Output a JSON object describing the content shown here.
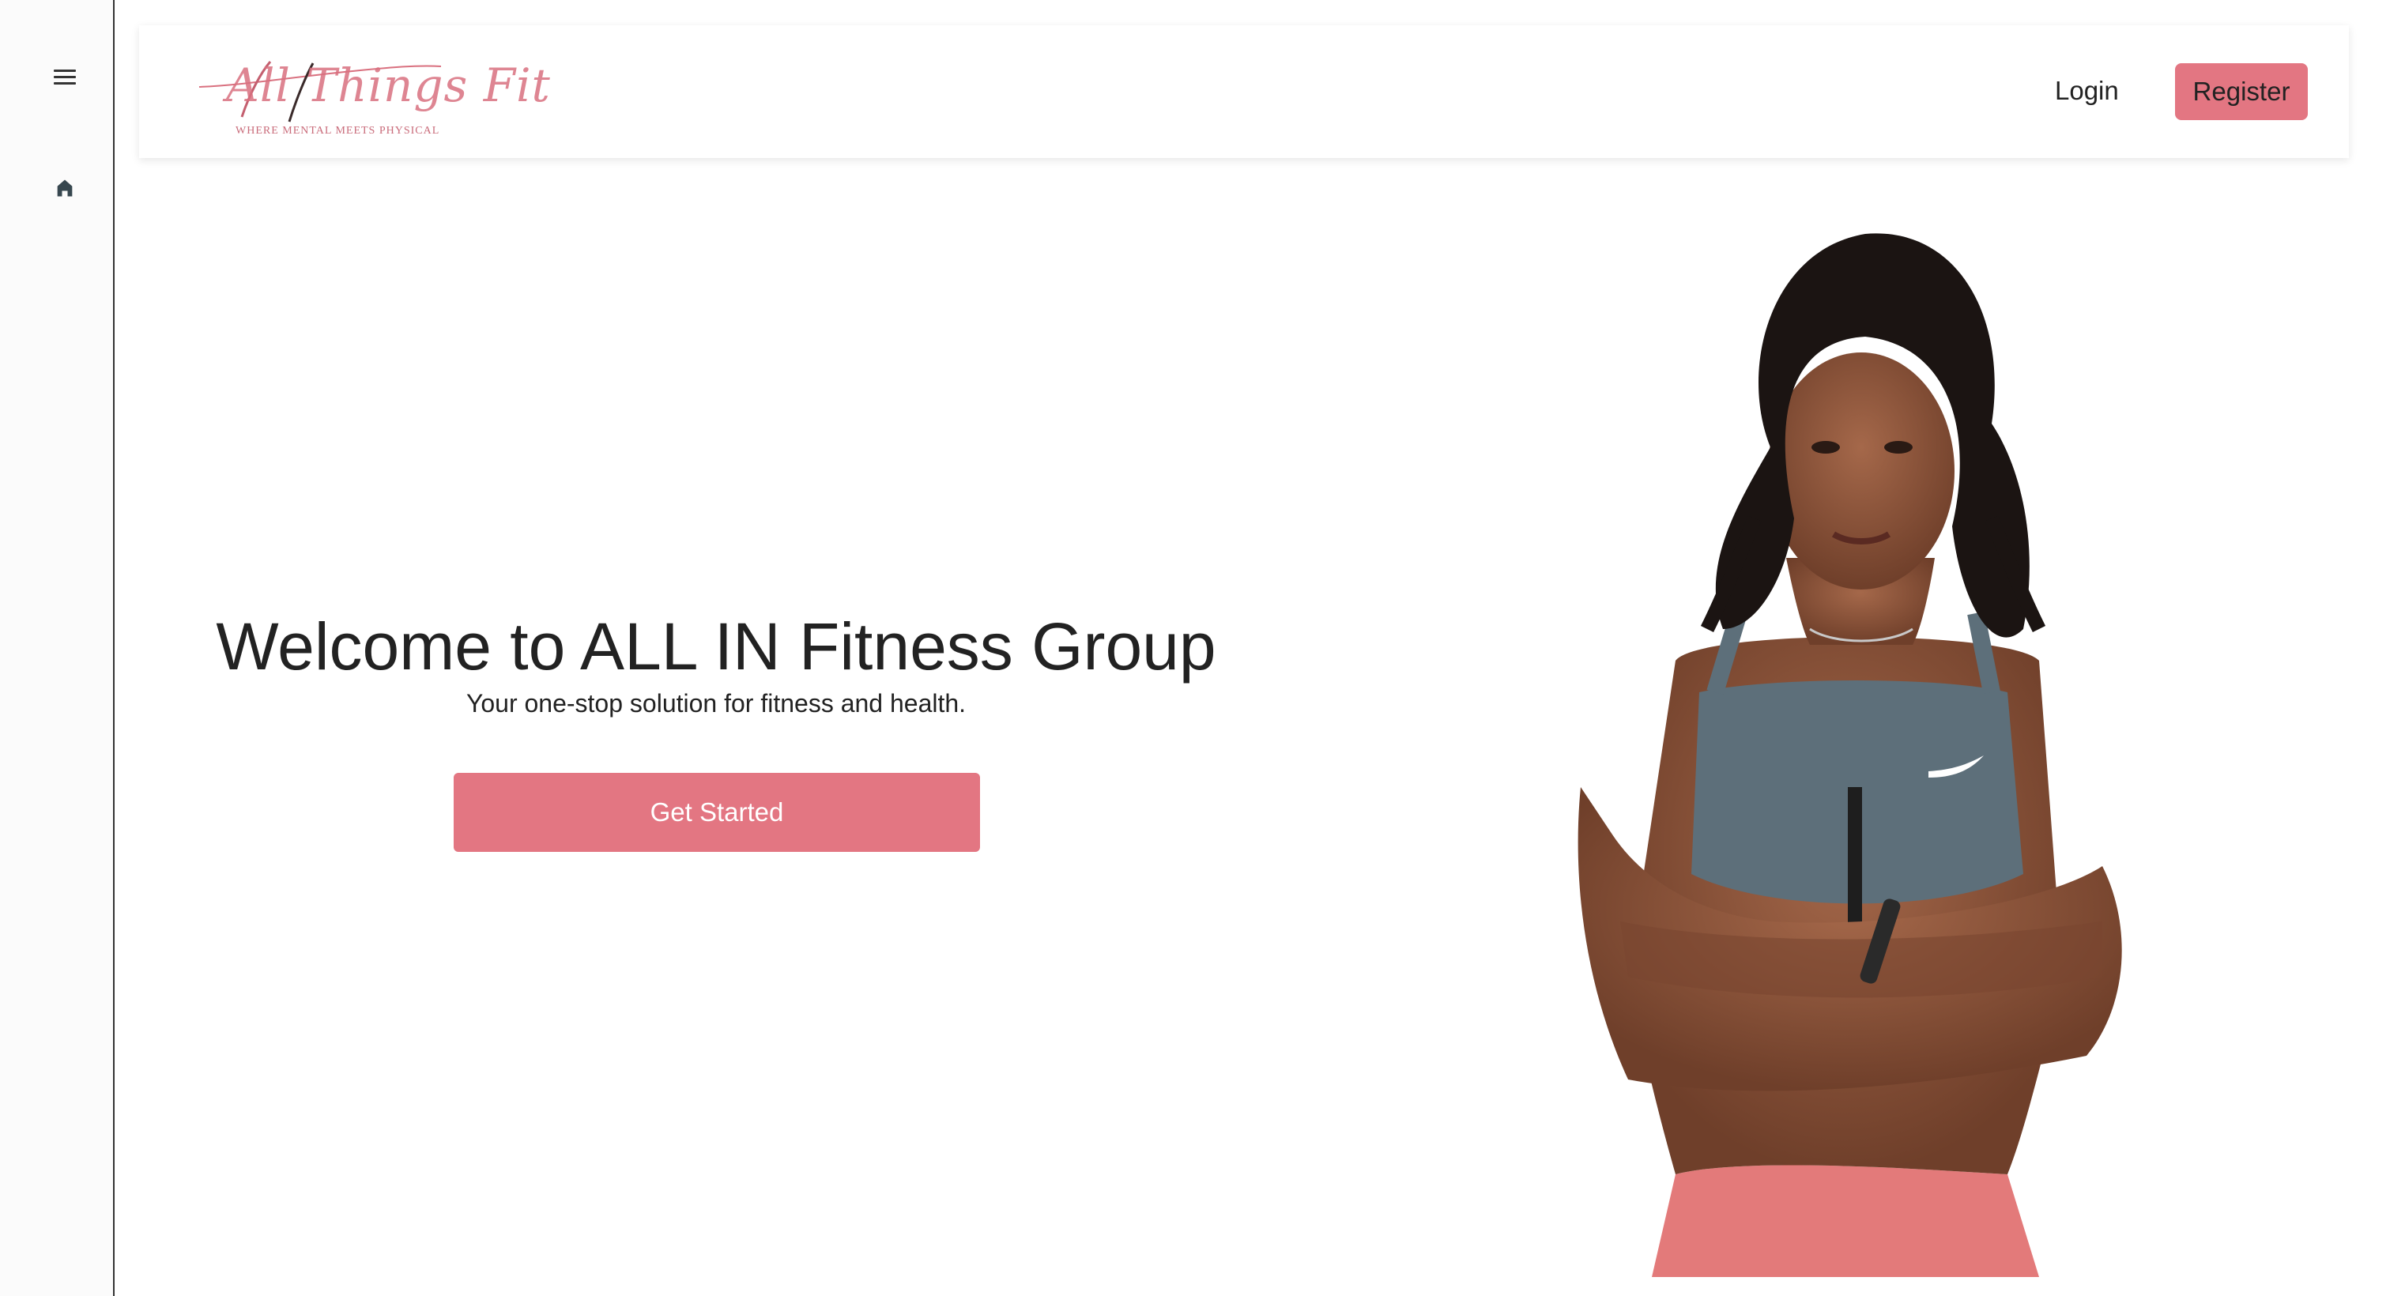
{
  "sidebar": {
    "menu_icon": "hamburger-menu-icon",
    "home_icon": "home-icon"
  },
  "navbar": {
    "logo_script": "All Things Fit",
    "logo_tagline": "WHERE MENTAL MEETS PHYSICAL",
    "login_label": "Login",
    "register_label": "Register"
  },
  "hero": {
    "title": "Welcome to ALL IN Fitness Group",
    "subtitle": "Your one-stop solution for fitness and health.",
    "cta_label": "Get Started"
  },
  "colors": {
    "accent": "#e37682",
    "text": "#222222",
    "sidebar_bg": "#fbfbfb"
  }
}
